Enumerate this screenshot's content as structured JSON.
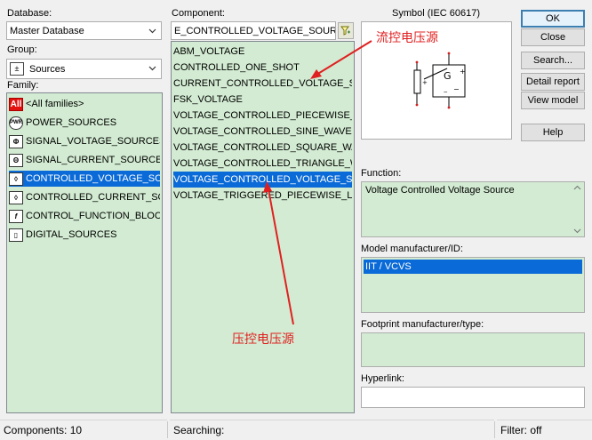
{
  "database": {
    "label": "Database:",
    "value": "Master Database"
  },
  "group": {
    "label": "Group:",
    "value": "Sources"
  },
  "family": {
    "label": "Family:",
    "items": [
      {
        "icon": "all-families-icon",
        "badge": "All",
        "label": "<All families>"
      },
      {
        "icon": "power-sources-icon",
        "badge": "PWR",
        "label": "POWER_SOURCES"
      },
      {
        "icon": "signal-voltage-icon",
        "badge": "Φ",
        "label": "SIGNAL_VOLTAGE_SOURCES"
      },
      {
        "icon": "signal-current-icon",
        "badge": "Θ",
        "label": "SIGNAL_CURRENT_SOURCES"
      },
      {
        "icon": "controlled-voltage-icon",
        "badge": "◊",
        "label": "CONTROLLED_VOLTAGE_SOURCES"
      },
      {
        "icon": "controlled-current-icon",
        "badge": "◊",
        "label": "CONTROLLED_CURRENT_SOURCES"
      },
      {
        "icon": "control-function-icon",
        "badge": "f",
        "label": "CONTROL_FUNCTION_BLOCKS"
      },
      {
        "icon": "digital-sources-icon",
        "badge": "▯",
        "label": "DIGITAL_SOURCES"
      }
    ],
    "selected_index": 4
  },
  "component": {
    "label": "Component:",
    "search_value": "E_CONTROLLED_VOLTAGE_SOURCE",
    "items": [
      "ABM_VOLTAGE",
      "CONTROLLED_ONE_SHOT",
      "CURRENT_CONTROLLED_VOLTAGE_SOURCE",
      "FSK_VOLTAGE",
      "VOLTAGE_CONTROLLED_PIECEWISE_LINEAR_SOURCE",
      "VOLTAGE_CONTROLLED_SINE_WAVE",
      "VOLTAGE_CONTROLLED_SQUARE_WAVE",
      "VOLTAGE_CONTROLLED_TRIANGLE_WAVE",
      "VOLTAGE_CONTROLLED_VOLTAGE_SOURCE",
      "VOLTAGE_TRIGGERED_PIECEWISE_LINEAR_SOURCE"
    ],
    "selected_index": 8
  },
  "symbol": {
    "label": "Symbol (IEC 60617)",
    "glyph": "G"
  },
  "buttons": {
    "ok": "OK",
    "close": "Close",
    "search": "Search...",
    "detail": "Detail report",
    "view_model": "View model",
    "help": "Help"
  },
  "function": {
    "label": "Function:",
    "value": "Voltage Controlled Voltage Source"
  },
  "model": {
    "label": "Model manufacturer/ID:",
    "value": "IIT / VCVS"
  },
  "footprint": {
    "label": "Footprint manufacturer/type:",
    "value": ""
  },
  "hyperlink": {
    "label": "Hyperlink:",
    "value": ""
  },
  "status": {
    "components": "Components: 10",
    "searching": "Searching:",
    "filter": "Filter: off"
  },
  "annotations": {
    "cccs_note": "流控电压源",
    "vcvs_note": "压控电压源"
  },
  "colors": {
    "list_bg": "#d2ebd2",
    "selection": "#0a6ad7",
    "annotation": "#e02020"
  }
}
